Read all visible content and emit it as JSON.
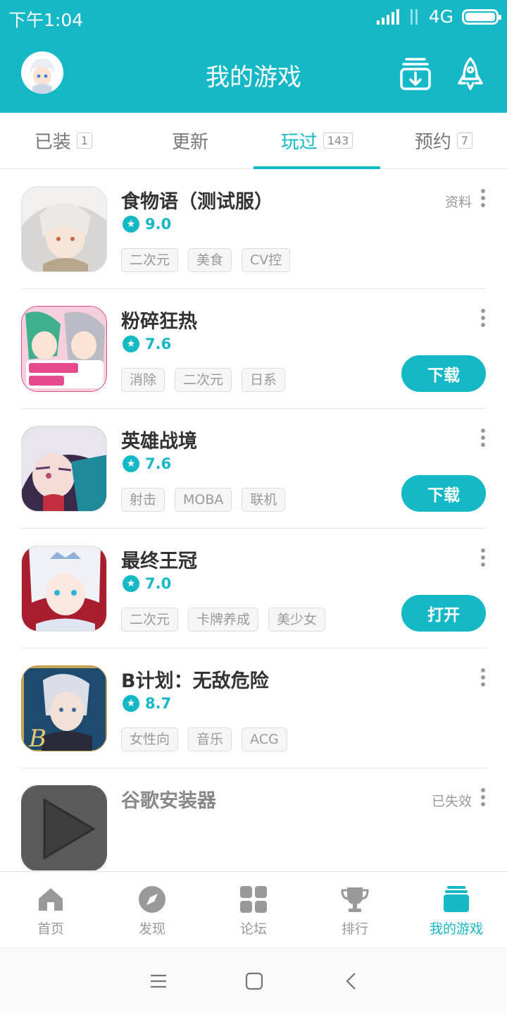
{
  "colors": {
    "accent": "#15b8c6",
    "tag_bg": "#f6f6f6",
    "muted_text": "#999999"
  },
  "status_bar": {
    "time": "下午1:04",
    "network": "4G"
  },
  "header": {
    "title": "我的游戏",
    "icons": [
      "avatar",
      "download-manager-icon",
      "rocket-icon"
    ]
  },
  "tabs": [
    {
      "label": "已装",
      "count": "1"
    },
    {
      "label": "更新",
      "count": ""
    },
    {
      "label": "玩过",
      "count": "143",
      "active": true
    },
    {
      "label": "预约",
      "count": "7"
    }
  ],
  "games": [
    {
      "name": "食物语（测试服）",
      "rating": "9.0",
      "tags": [
        "二次元",
        "美食",
        "CV控"
      ],
      "side_text": "资料",
      "button": ""
    },
    {
      "name": "粉碎狂热",
      "rating": "7.6",
      "tags": [
        "消除",
        "二次元",
        "日系"
      ],
      "side_text": "",
      "button": "下载"
    },
    {
      "name": "英雄战境",
      "rating": "7.6",
      "tags": [
        "射击",
        "MOBA",
        "联机"
      ],
      "side_text": "",
      "button": "下载"
    },
    {
      "name": "最终王冠",
      "rating": "7.0",
      "tags": [
        "二次元",
        "卡牌养成",
        "美少女"
      ],
      "side_text": "",
      "button": "打开"
    },
    {
      "name": "B计划：无敌危险",
      "rating": "8.7",
      "tags": [
        "女性向",
        "音乐",
        "ACG"
      ],
      "side_text": "",
      "button": ""
    },
    {
      "name": "谷歌安装器",
      "rating": "",
      "tags": [],
      "side_text": "已失效",
      "button": ""
    }
  ],
  "bottom_nav": [
    {
      "label": "首页",
      "icon": "home-icon"
    },
    {
      "label": "发现",
      "icon": "compass-icon"
    },
    {
      "label": "论坛",
      "icon": "grid-icon"
    },
    {
      "label": "排行",
      "icon": "trophy-icon"
    },
    {
      "label": "我的游戏",
      "icon": "my-games-icon",
      "active": true
    }
  ]
}
